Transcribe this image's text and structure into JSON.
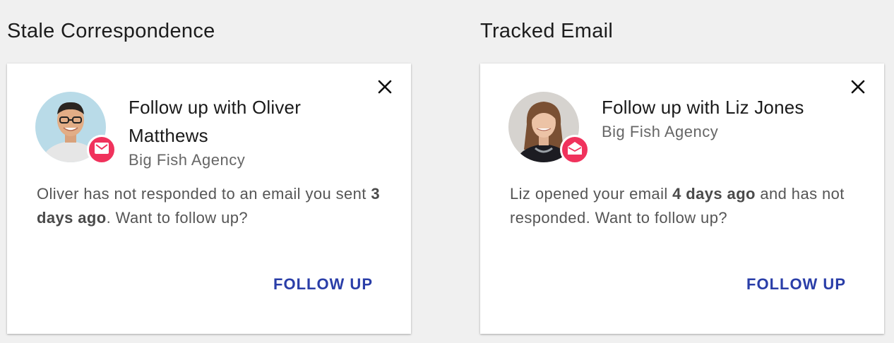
{
  "sections": [
    {
      "heading": "Stale Correspondence",
      "card": {
        "title": "Follow up with Oliver Matthews",
        "company": "Big Fish Agency",
        "body_pre": "Oliver has not responded to an email you sent ",
        "body_emph": "3 days ago",
        "body_post": ". Want to follow up?",
        "action_label": "FOLLOW UP",
        "badge_icon": "envelope-closed-icon"
      }
    },
    {
      "heading": "Tracked Email",
      "card": {
        "title": "Follow up with Liz Jones",
        "company": "Big Fish Agency",
        "body_pre": "Liz opened your email ",
        "body_emph": "4 days ago",
        "body_post": " and has not responded. Want to follow up?",
        "action_label": "FOLLOW UP",
        "badge_icon": "envelope-open-icon"
      }
    }
  ],
  "colors": {
    "page_bg": "#f0f0f0",
    "card_bg": "#ffffff",
    "badge": "#f0325c",
    "action": "#2a3ea8"
  }
}
